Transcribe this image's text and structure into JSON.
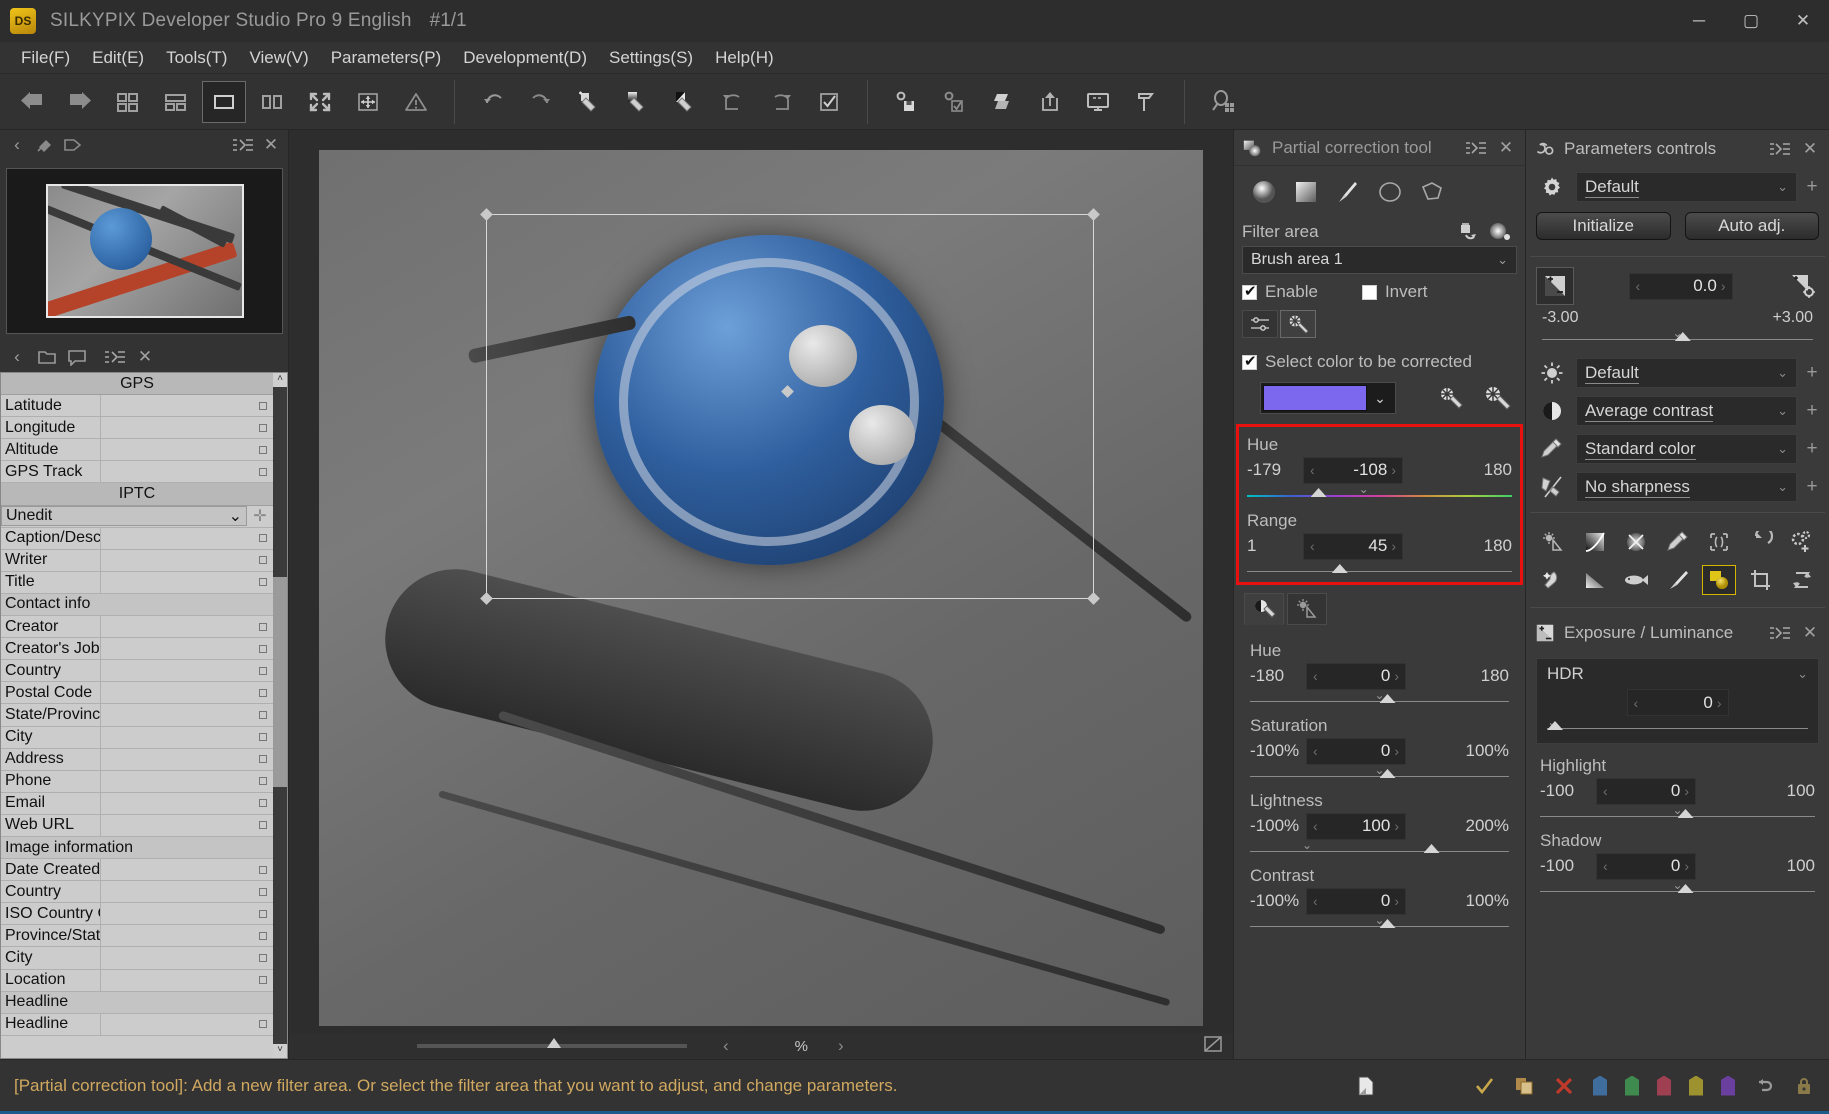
{
  "app": {
    "title": "SILKYPIX Developer Studio Pro 9 English",
    "image_count": "#1/1",
    "logo_text": "DS"
  },
  "window_controls": {
    "minimize": "─",
    "maximize": "▢",
    "close": "✕"
  },
  "menubar": [
    {
      "label": "File(F)",
      "accel": "F"
    },
    {
      "label": "Edit(E)",
      "accel": "E"
    },
    {
      "label": "Tools(T)",
      "accel": "T"
    },
    {
      "label": "View(V)",
      "accel": "V"
    },
    {
      "label": "Parameters(P)",
      "accel": "P"
    },
    {
      "label": "Development(D)",
      "accel": "D"
    },
    {
      "label": "Settings(S)",
      "accel": "S"
    },
    {
      "label": "Help(H)",
      "accel": "H"
    }
  ],
  "toolbar": {
    "groups": [
      [
        "prev-image-icon",
        "next-image-icon",
        "thumbnail-grid-icon",
        "thumbnail-list-icon",
        "single-view-icon",
        "compare-view-icon",
        "fullscreen-icon",
        "fit-screen-icon",
        "warning-icon"
      ],
      [
        "undo-icon",
        "redo-icon",
        "white-balance-picker-icon",
        "gray-balance-picker-icon",
        "black-balance-picker-icon",
        "rotate-left-icon",
        "rotate-right-icon",
        "checkmark-box-icon"
      ],
      [
        "save-settings-icon",
        "apply-settings-icon",
        "batch-develop-icon",
        "export-icon",
        "display-icon",
        "stamp-icon"
      ],
      [
        "search-thumbnail-icon"
      ]
    ]
  },
  "left_panel": {
    "header_icons": [
      "collapse-left-icon",
      "pin-icon",
      "tag-icon",
      "menu-icon",
      "close-icon"
    ],
    "thumbnail_name": "fishing-reel-thumbnail",
    "meta_header_icons": [
      "collapse-left-icon",
      "folder-icon",
      "comment-icon",
      "menu-icon",
      "close-icon"
    ],
    "sections": [
      {
        "type": "section",
        "label": "GPS"
      },
      {
        "type": "row",
        "label": "Latitude",
        "value": ""
      },
      {
        "type": "row",
        "label": "Longitude",
        "value": ""
      },
      {
        "type": "row",
        "label": "Altitude",
        "value": ""
      },
      {
        "type": "row",
        "label": "GPS Track",
        "value": ""
      },
      {
        "type": "section",
        "label": "IPTC"
      },
      {
        "type": "combo",
        "label": "Unedit",
        "value": "Unedit"
      },
      {
        "type": "row",
        "label": "Caption/Descr",
        "value": ""
      },
      {
        "type": "row",
        "label": "Writer",
        "value": ""
      },
      {
        "type": "row",
        "label": "Title",
        "value": ""
      },
      {
        "type": "subsection",
        "label": "Contact info"
      },
      {
        "type": "row",
        "label": "Creator",
        "value": ""
      },
      {
        "type": "row",
        "label": "Creator's Jobti",
        "value": ""
      },
      {
        "type": "row",
        "label": "Country",
        "value": ""
      },
      {
        "type": "row",
        "label": "Postal Code",
        "value": ""
      },
      {
        "type": "row",
        "label": "State/Province",
        "value": ""
      },
      {
        "type": "row",
        "label": "City",
        "value": ""
      },
      {
        "type": "row",
        "label": "Address",
        "value": ""
      },
      {
        "type": "row",
        "label": "Phone",
        "value": ""
      },
      {
        "type": "row",
        "label": "Email",
        "value": ""
      },
      {
        "type": "row",
        "label": "Web URL",
        "value": ""
      },
      {
        "type": "subsection",
        "label": "Image information"
      },
      {
        "type": "row",
        "label": "Date Created",
        "value": ""
      },
      {
        "type": "row",
        "label": "Country",
        "value": ""
      },
      {
        "type": "row",
        "label": "ISO Country C",
        "value": ""
      },
      {
        "type": "row",
        "label": "Province/State",
        "value": ""
      },
      {
        "type": "row",
        "label": "City",
        "value": ""
      },
      {
        "type": "row",
        "label": "Location",
        "value": ""
      },
      {
        "type": "subsection",
        "label": "Headline"
      },
      {
        "type": "row",
        "label": "Headline",
        "value": ""
      }
    ]
  },
  "image_area": {
    "zoom_unit": "%",
    "zoom_value": ""
  },
  "partial_correction": {
    "title": "Partial correction tool",
    "header_icons": [
      "panel-icon",
      "menu-icon",
      "close-icon"
    ],
    "shape_tabs": [
      "circular-gradient-icon",
      "linear-gradient-icon",
      "brush-icon",
      "ellipse-icon",
      "polygon-icon"
    ],
    "filter_area_label": "Filter area",
    "filter_area_tool_icons": [
      "reset-filter-icon",
      "mask-preview-icon"
    ],
    "filter_area_value": "Brush area 1",
    "enable_label": "Enable",
    "enable_checked": true,
    "invert_label": "Invert",
    "invert_checked": false,
    "mode_icons": [
      "slider-mode-icon",
      "mask-mode-icon"
    ],
    "select_color_label": "Select color to be corrected",
    "select_color_checked": true,
    "color_swatch": "#7b68ee",
    "picker_icons": [
      "color-picker-icon",
      "color-range-picker-icon"
    ],
    "sliders_highlighted": [
      {
        "name": "Hue",
        "min": "-179",
        "max": "180",
        "value": "-108",
        "pos_pct": 26,
        "track": "hue"
      },
      {
        "name": "Range",
        "min": "1",
        "max": "180",
        "value": "45",
        "pos_pct": 34,
        "track": "plain"
      }
    ],
    "lower_tabs": [
      "color-adjust-tab-icon",
      "exposure-adjust-tab-icon"
    ],
    "lower_sliders": [
      {
        "name": "Hue",
        "min": "-180",
        "max": "180",
        "value": "0",
        "pos_pct": 50
      },
      {
        "name": "Saturation",
        "min": "-100%",
        "max": "100%",
        "value": "0",
        "pos_pct": 50
      },
      {
        "name": "Lightness",
        "min": "-100%",
        "max": "200%",
        "value": "100",
        "pos_pct": 67
      },
      {
        "name": "Contrast",
        "min": "-100%",
        "max": "100%",
        "value": "0",
        "pos_pct": 50
      }
    ]
  },
  "parameters_controls": {
    "title": "Parameters controls",
    "header_icons": [
      "parameters-icon",
      "menu-icon",
      "close-icon"
    ],
    "taste_value": "Default",
    "taste_icon": "gear-icon",
    "initialize_label": "Initialize",
    "auto_adj_label": "Auto adj.",
    "exposure": {
      "icon": "exposure-bias-icon",
      "value": "0.0",
      "min": "-3.00",
      "max": "+3.00",
      "pos_pct": 50,
      "aux_icon": "exposure-settings-icon"
    },
    "combos": [
      {
        "icon": "brightness-icon",
        "value": "Default"
      },
      {
        "icon": "contrast-icon",
        "value": "Average contrast"
      },
      {
        "icon": "color-icon",
        "value": "Standard color"
      },
      {
        "icon": "sharpness-icon",
        "value": "No sharpness"
      }
    ],
    "tool_grid": [
      [
        "tone-curve-tool-icon",
        "gradation-tool-icon",
        "noise-reduction-icon",
        "color-tool-icon",
        "lens-aberration-icon",
        "rotation-icon",
        "settings-plus-icon"
      ],
      [
        "dodge-burn-icon",
        "gradient-filter-icon",
        "fisheye-icon",
        "brush-tool-icon",
        "partial-correction-icon",
        "crop-icon",
        "transform-icon"
      ]
    ],
    "tool_grid_selected": [
      1,
      4
    ]
  },
  "exposure_luminance": {
    "title": "Exposure / Luminance",
    "header_icons": [
      "exposure-icon",
      "menu-icon",
      "close-icon"
    ],
    "hdr_label": "HDR",
    "hdr_value": "0",
    "hdr_pos_pct": 2,
    "sliders": [
      {
        "name": "Highlight",
        "min": "-100",
        "max": "100",
        "value": "0",
        "pos_pct": 50
      },
      {
        "name": "Shadow",
        "min": "-100",
        "max": "100",
        "value": "0",
        "pos_pct": 50
      }
    ]
  },
  "statusbar": {
    "message": "[Partial correction tool]: Add a new filter area. Or select the filter area that you want to adjust, and change parameters.",
    "icons": [
      {
        "name": "page-icon",
        "color": "#d8d8d8"
      },
      {
        "name": "check-icon",
        "color": "#c8a84a"
      },
      {
        "name": "copy-icon",
        "color": "#b08a4a"
      },
      {
        "name": "delete-icon",
        "color": "#c0392b"
      },
      {
        "name": "tag-blue-icon",
        "color": "#3f6e9e"
      },
      {
        "name": "tag-green-icon",
        "color": "#3f8a4e"
      },
      {
        "name": "tag-red-icon",
        "color": "#9e3f52"
      },
      {
        "name": "tag-yellow-icon",
        "color": "#9e9130"
      },
      {
        "name": "tag-purple-icon",
        "color": "#6a3f9e"
      },
      {
        "name": "undo-icon",
        "color": "#9a9a9a"
      },
      {
        "name": "lock-icon",
        "color": "#8a7a4a"
      }
    ]
  }
}
